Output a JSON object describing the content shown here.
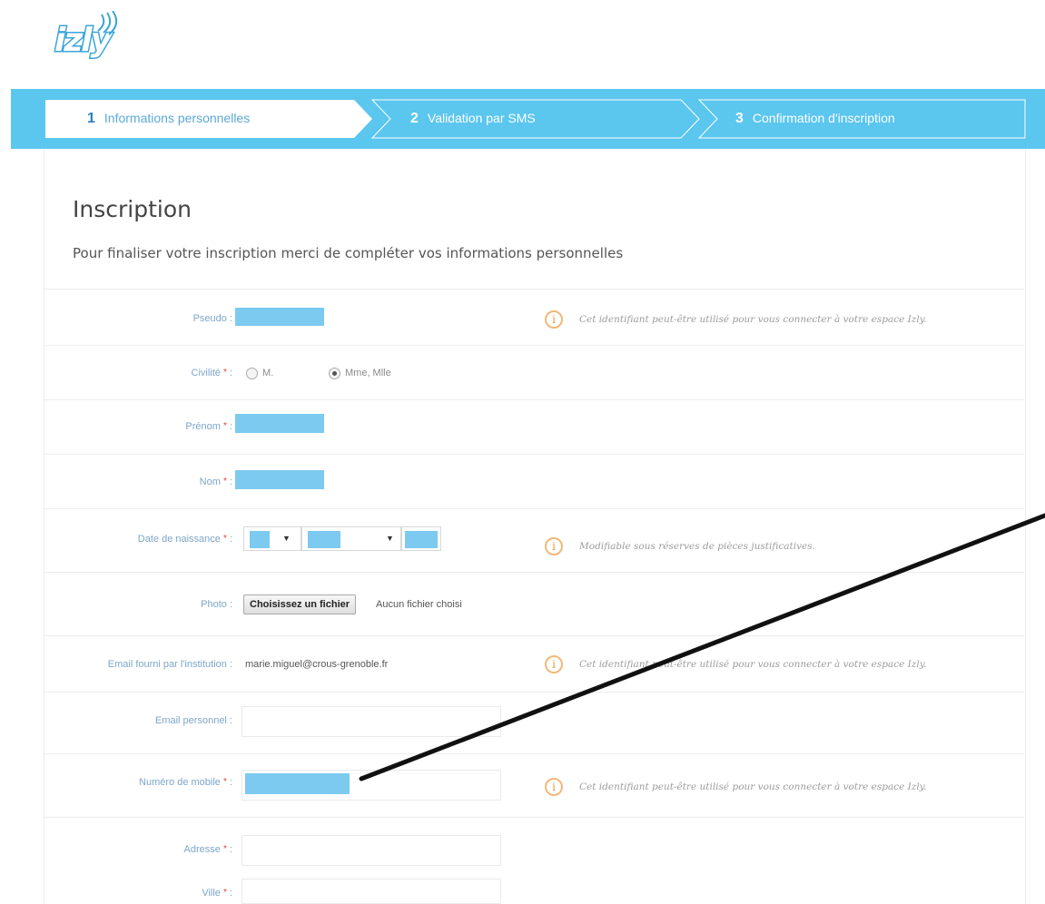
{
  "logo": {
    "text": "izly"
  },
  "steps": [
    {
      "num": "1",
      "label": "Informations personnelles",
      "active": true
    },
    {
      "num": "2",
      "label": "Validation par SMS",
      "active": false
    },
    {
      "num": "3",
      "label": "Confirmation d'inscription",
      "active": false
    }
  ],
  "page": {
    "title": "Inscription",
    "subtitle": "Pour finaliser votre inscription merci de compléter vos informations personnelles"
  },
  "form": {
    "pseudo_label": "Pseudo :",
    "pseudo_hint": "Cet identifiant peut-être utilisé pour vous connecter à votre espace Izly.",
    "civilite_label": "Civilité",
    "civilite_options": [
      "M.",
      "Mme, Mlle"
    ],
    "civilite_selected": "Mme, Mlle",
    "prenom_label": "Prénom",
    "nom_label": "Nom",
    "birth_label": "Date de naissance",
    "birth_hint": "Modifiable sous réserves de pièces justificatives.",
    "photo_label": "Photo :",
    "photo_button": "Choisissez un fichier",
    "photo_status": "Aucun fichier choisi",
    "email_inst_label": "Email fourni par l'institution :",
    "email_inst_value": "marie.miguel@crous-grenoble.fr",
    "email_inst_hint": "Cet identifiant peut-être utilisé pour vous connecter à votre espace Izly.",
    "email_perso_label": "Email personnel :",
    "mobile_label": "Numéro de mobile",
    "mobile_hint": "Cet identifiant peut-être utilisé pour vous connecter à votre espace Izly.",
    "adresse_label": "Adresse",
    "ville_label": "Ville",
    "required_mark": "*",
    "colon": ":"
  },
  "icons": {
    "info": "info-icon",
    "select_caret": "caret-down-icon"
  },
  "colors": {
    "accent": "#5bc6ee",
    "redaction": "#7ccaf0",
    "required": "#e0413b",
    "info": "#f0b87a"
  }
}
